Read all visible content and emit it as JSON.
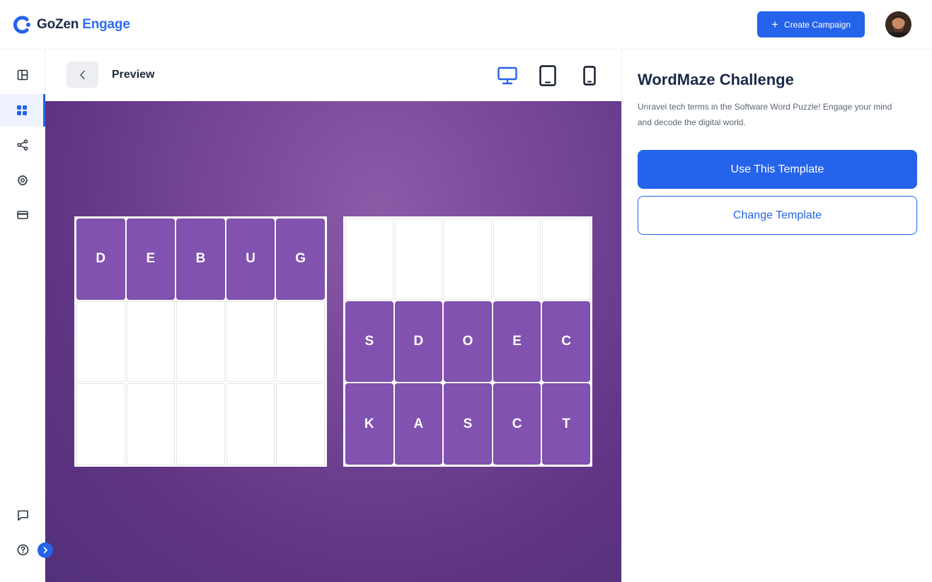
{
  "brand": {
    "name_part1": "GoZen",
    "name_part2": "Engage",
    "accent_color": "#2563eb"
  },
  "header": {
    "create_campaign_label": "Create Campaign",
    "create_icon": "plus-icon"
  },
  "sidebar": {
    "items": [
      {
        "name": "layout",
        "icon": "layout-icon"
      },
      {
        "name": "templates",
        "icon": "grid-icon",
        "active": true
      },
      {
        "name": "share",
        "icon": "share-icon"
      },
      {
        "name": "settings",
        "icon": "gear-icon"
      },
      {
        "name": "billing",
        "icon": "card-icon"
      }
    ],
    "bottom": [
      {
        "name": "feedback",
        "icon": "chat-icon"
      },
      {
        "name": "help",
        "icon": "help-icon"
      }
    ]
  },
  "preview": {
    "title": "Preview",
    "devices": [
      "desktop",
      "tablet",
      "mobile"
    ],
    "active_device": "desktop"
  },
  "puzzle": {
    "left_grid": [
      [
        "D",
        "E",
        "B",
        "U",
        "G"
      ],
      [
        "",
        "",
        "",
        "",
        ""
      ],
      [
        "",
        "",
        "",
        "",
        ""
      ]
    ],
    "right_grid": [
      [
        "",
        "",
        "",
        "",
        ""
      ],
      [
        "S",
        "D",
        "O",
        "E",
        "C"
      ],
      [
        "K",
        "A",
        "S",
        "C",
        "T"
      ]
    ],
    "tile_color": "#8152b0"
  },
  "panel": {
    "title": "WordMaze Challenge",
    "description": "Unravel tech terms in the Software Word Puzzle! Engage your mind and decode the digital world.",
    "use_template_label": "Use This Template",
    "change_template_label": "Change Template"
  }
}
